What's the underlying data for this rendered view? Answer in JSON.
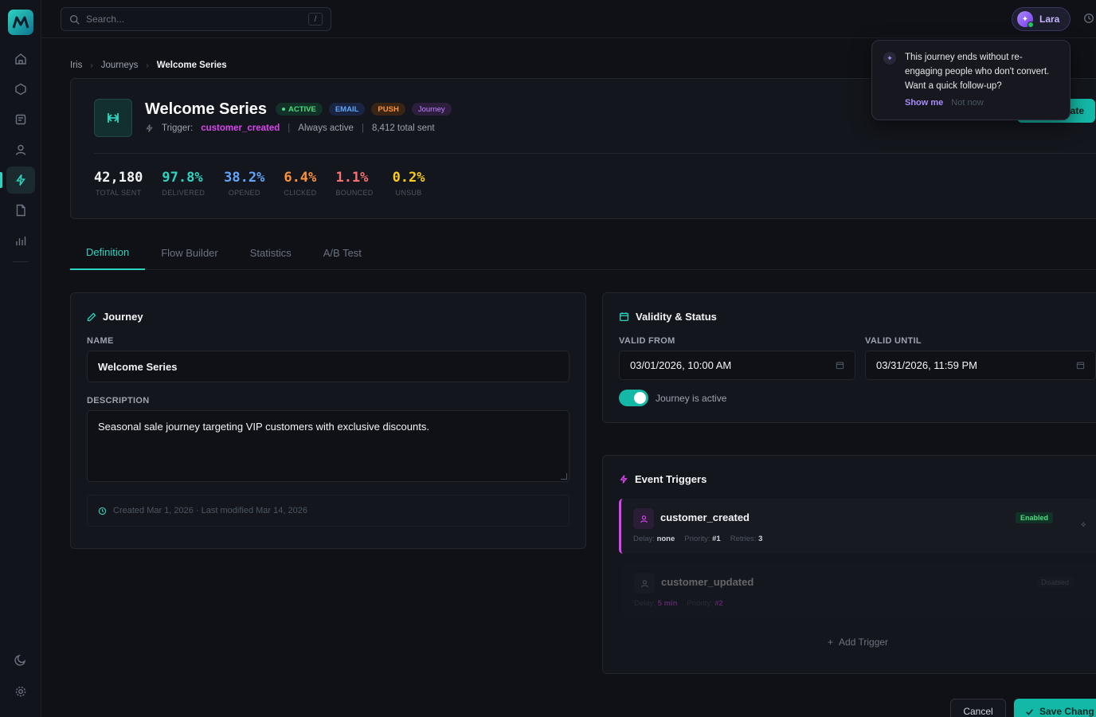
{
  "app": {
    "logo_icon": "m-logo-icon",
    "accent": "#2dd4bf"
  },
  "sidebar": {
    "items": [
      {
        "name": "home-icon"
      },
      {
        "name": "cube-icon"
      },
      {
        "name": "document-icon"
      },
      {
        "name": "user-icon"
      },
      {
        "name": "lightning-icon",
        "active": true
      },
      {
        "name": "file-icon"
      },
      {
        "name": "bar-chart-icon"
      }
    ],
    "bottom": [
      {
        "name": "moon-icon"
      },
      {
        "name": "settings-icon"
      }
    ]
  },
  "topbar": {
    "search_placeholder": "Search...",
    "search_shortcut": "/",
    "user_name": "Lara",
    "avatar_glyph": "✦"
  },
  "popover": {
    "glyph": "✦",
    "text": "This journey ends without re-engaging people who don't convert. Want a quick follow-up?",
    "show_me": "Show me",
    "not_now": "Not now"
  },
  "breadcrumb": [
    "Iris",
    "Journeys",
    "Welcome Series"
  ],
  "journey": {
    "title": "Welcome Series",
    "badges": {
      "active": "ACTIVE",
      "email": "EMAIL",
      "push": "PUSH",
      "journey": "Journey"
    },
    "trigger_label": "Trigger:",
    "trigger_event": "customer_created",
    "availability": "Always active",
    "total_sent": "8,412 total sent",
    "create_label": "ate"
  },
  "stats": [
    {
      "value": "42,180",
      "label": "TOTAL SENT",
      "color": "#f3f4f6"
    },
    {
      "value": "97.8%",
      "label": "DELIVERED",
      "color": "#2dd4bf"
    },
    {
      "value": "38.2%",
      "label": "OPENED",
      "color": "#60a5fa"
    },
    {
      "value": "6.4%",
      "label": "CLICKED",
      "color": "#fb923c"
    },
    {
      "value": "1.1%",
      "label": "BOUNCED",
      "color": "#f87171"
    },
    {
      "value": "0.2%",
      "label": "UNSUB",
      "color": "#facc15"
    }
  ],
  "tabs": [
    "Definition",
    "Flow Builder",
    "Statistics",
    "A/B Test"
  ],
  "journey_panel": {
    "title": "Journey",
    "name_label": "NAME",
    "name_value": "Welcome Series",
    "desc_label": "DESCRIPTION",
    "desc_value": "Seasonal sale journey targeting VIP customers with exclusive discounts.",
    "meta": "Created Mar 1, 2026 · Last modified Mar 14, 2026"
  },
  "validity_panel": {
    "title": "Validity & Status",
    "from_label": "VALID FROM",
    "from_value": "03/01/2026, 10:00 AM",
    "until_label": "VALID UNTIL",
    "until_value": "03/31/2026, 11:59 PM",
    "toggle_label": "Journey is active"
  },
  "triggers_panel": {
    "title": "Event Triggers",
    "items": [
      {
        "name": "customer_created",
        "status": "Enabled",
        "delay_label": "Delay:",
        "delay": "none",
        "priority_label": "Priority:",
        "priority": "#1",
        "retries_label": "Retries:",
        "retries": "3"
      },
      {
        "name": "customer_updated",
        "status": "Disabled",
        "delay_label": "Delay:",
        "delay": "5 min",
        "priority_label": "Priority:",
        "priority": "#2"
      }
    ],
    "add_label": "Add Trigger"
  },
  "footer": {
    "cancel": "Cancel",
    "save": "Save Chang"
  }
}
